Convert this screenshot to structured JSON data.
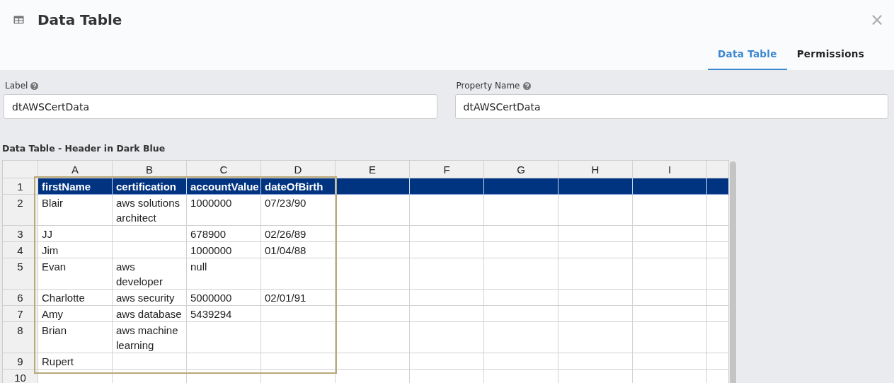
{
  "dialog": {
    "title": "Data Table",
    "close": "×"
  },
  "tabs": [
    {
      "label": "Data Table",
      "selected": true
    },
    {
      "label": "Permissions",
      "selected": false
    }
  ],
  "fields": [
    {
      "label": "Label",
      "value": "dtAWSCertData"
    },
    {
      "label": "Property Name",
      "value": "dtAWSCertData"
    }
  ],
  "section_title": "Data Table - Header in Dark Blue",
  "table": {
    "columns": [
      "A",
      "B",
      "C",
      "D",
      "E",
      "F",
      "G",
      "H",
      "I"
    ],
    "rows": [
      {
        "number": "1",
        "kind": "header",
        "cells": [
          "firstName",
          "certification",
          "accountValue",
          "dateOfBirth"
        ]
      },
      {
        "number": "2",
        "kind": "data",
        "cells": [
          "Blair",
          "aws solutions\narchitect",
          "1000000",
          "07/23/90"
        ]
      },
      {
        "number": "3",
        "kind": "data",
        "cells": [
          "JJ",
          "",
          "678900",
          "02/26/89"
        ]
      },
      {
        "number": "4",
        "kind": "data",
        "cells": [
          "Jim",
          "",
          "1000000",
          "01/04/88"
        ]
      },
      {
        "number": "5",
        "kind": "data",
        "cells": [
          "Evan",
          "aws\ndeveloper",
          "null",
          ""
        ]
      },
      {
        "number": "6",
        "kind": "data",
        "cells": [
          "Charlotte",
          "aws security",
          "5000000",
          "02/01/91"
        ]
      },
      {
        "number": "7",
        "kind": "data",
        "cells": [
          "Amy",
          "aws database",
          "5439294",
          ""
        ]
      },
      {
        "number": "8",
        "kind": "data",
        "cells": [
          "Brian",
          "aws machine\nlearning",
          "",
          ""
        ]
      },
      {
        "number": "9",
        "kind": "data",
        "cells": [
          "Rupert",
          "",
          "",
          ""
        ]
      },
      {
        "number": "10",
        "kind": "data",
        "cells": []
      }
    ]
  }
}
